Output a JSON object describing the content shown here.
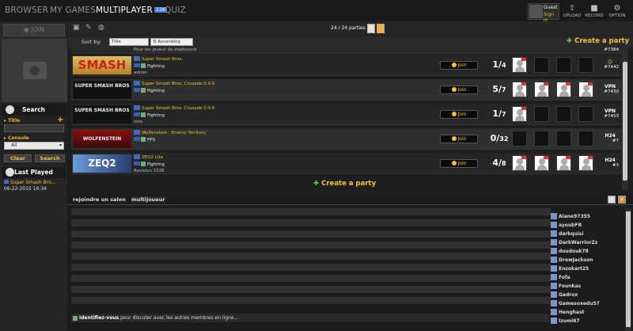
{
  "nav": {
    "items": [
      "BROWSER",
      "MY GAMES",
      "MULTIPLAYER",
      "QUIZ"
    ],
    "multiplayer_count": "226"
  },
  "user": {
    "name": "Guest",
    "signin": "Sign in"
  },
  "toolbar_right": [
    "UPLOAD",
    "RECORD",
    "OPTION"
  ],
  "join_label": "JOIN",
  "search": {
    "header": "Search",
    "title_label": "Title",
    "console_label": "Console",
    "console_value": "All",
    "clear": "Clear",
    "search": "Search"
  },
  "last_played": {
    "header": "Last Played",
    "game": "Super Smash Bro...",
    "date": "06-22-2015",
    "time": "16:34"
  },
  "list": {
    "count": "24 / 24 parties",
    "sort_by": "Sort by:",
    "sort_field": "Title",
    "sort_order": "Ascending",
    "create": "Create a party",
    "partial_desc": "Pour les joueur de starbound",
    "partial_id": "#7384",
    "rows": [
      {
        "thumb": "SMASH",
        "title": "Super Smash Bros.",
        "genre": "Fighting",
        "desc": "adrien",
        "join": "Join",
        "players": "1",
        "max": "4",
        "id": "#7442",
        "badge": ""
      },
      {
        "thumb": "SUPER SMASH BROS",
        "title": "Super Smash Bros. Crusade 0.9.0",
        "genre": "Fighting",
        "desc": "",
        "join": "Join",
        "players": "5",
        "max": "7",
        "id": "#7430",
        "badge": "VPN"
      },
      {
        "thumb": "SUPER SMASH BROS",
        "title": "Super Smash Bros. Crusade 0.9.0",
        "genre": "Fighting",
        "desc": "toto",
        "join": "Join",
        "players": "1",
        "max": "7",
        "id": "#7453",
        "badge": "VPN"
      },
      {
        "thumb": "WOLFENSTEIN",
        "title": "Wolfenstein : Enemy Territory",
        "genre": "FPS",
        "desc": "",
        "join": "Join",
        "players": "0",
        "max": "32",
        "id": "#7",
        "badge": "H24"
      },
      {
        "thumb": "ZEQ2",
        "title": "ZEQ2 Lite",
        "genre": "Fighting",
        "desc": "Revision 1536",
        "join": "Join",
        "players": "4",
        "max": "8",
        "id": "#3",
        "badge": "H24"
      }
    ]
  },
  "chat": {
    "tabs": [
      "rejoindre un salon",
      "multijoueur"
    ],
    "notice_bold": "Identifiez-vous",
    "notice_rest": " pour discuter avec les autres membres en ligne...",
    "users": [
      "Alane97355",
      "ayoubFR",
      "darkquisi",
      "DarkWarriorZz",
      "doudouk78",
      "DrewJackson",
      "Enzokart25",
      "Fofa",
      "Founkas",
      "Gadrox",
      "Gamesoxedu57",
      "Henghast",
      "Izumi67"
    ]
  }
}
